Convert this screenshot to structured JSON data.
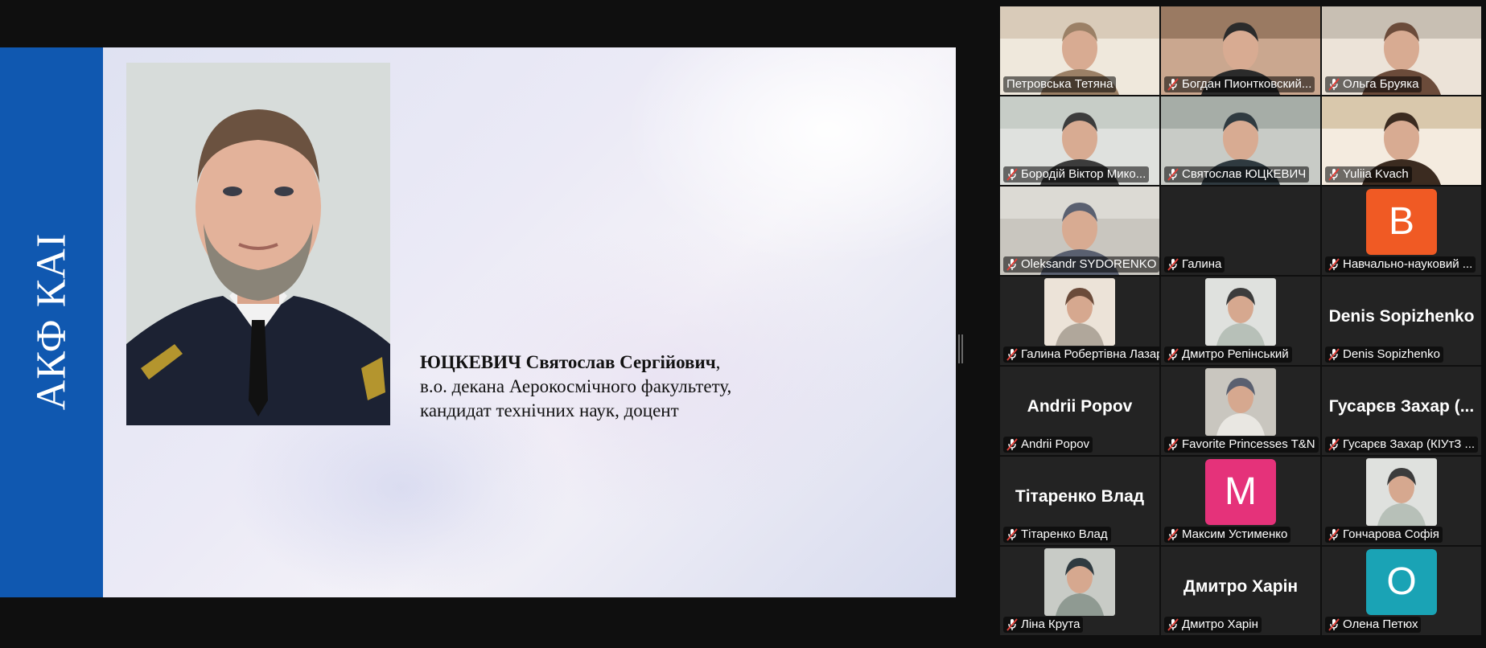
{
  "slide": {
    "band_text": "АКФ КАІ",
    "name_bold": "ЮЦКЕВИЧ Святослав Сергійович",
    "name_suffix": ",",
    "line2": "в.о. декана Аерокосмічного факультету,",
    "line3": "кандидат технічних наук, доцент",
    "band_color": "#1058b0"
  },
  "participants": [
    {
      "name": "Петровська Тетяна",
      "muted": false,
      "active": true,
      "kind": "video"
    },
    {
      "name": "Богдан Пионтковский...",
      "muted": true,
      "kind": "video"
    },
    {
      "name": "Ольга Бруяка",
      "muted": true,
      "kind": "video"
    },
    {
      "name": "Бородій Віктор Мико...",
      "muted": true,
      "kind": "video"
    },
    {
      "name": "Святослав ЮЦКЕВИЧ",
      "muted": true,
      "kind": "video"
    },
    {
      "name": "Yuliia Kvach",
      "muted": true,
      "kind": "video"
    },
    {
      "name": "Oleksandr SYDORENKO",
      "muted": true,
      "kind": "video"
    },
    {
      "name": "Галина",
      "muted": true,
      "kind": "blank"
    },
    {
      "name": "Навчально-науковий ...",
      "muted": true,
      "kind": "avatar",
      "letter": "B",
      "color": "#f05a24"
    },
    {
      "name": "Галина Робертівна Лазар...",
      "muted": true,
      "kind": "photo"
    },
    {
      "name": "Дмитро Репінський",
      "muted": true,
      "kind": "photo"
    },
    {
      "name": "Denis Sopizhenko",
      "muted": true,
      "kind": "text",
      "big": "Denis Sopizhenko"
    },
    {
      "name": "Andrii Popov",
      "muted": true,
      "kind": "text",
      "big": "Andrii Popov"
    },
    {
      "name": "Favorite Princesses T&N",
      "muted": true,
      "kind": "photo"
    },
    {
      "name": "Гусарєв Захар (КІУтЗ ...",
      "muted": true,
      "kind": "text",
      "big": "Гусарєв Захар (..."
    },
    {
      "name": "Тітаренко Влад",
      "muted": true,
      "kind": "text",
      "big": "Тітаренко Влад"
    },
    {
      "name": "Максим Устименко",
      "muted": true,
      "kind": "avatar",
      "letter": "M",
      "color": "#e5327a"
    },
    {
      "name": "Гончарова Софія",
      "muted": true,
      "kind": "photo"
    },
    {
      "name": "Ліна Крута",
      "muted": true,
      "kind": "photo"
    },
    {
      "name": "Дмитро Харін",
      "muted": true,
      "kind": "text",
      "big": "Дмитро Харін"
    },
    {
      "name": "Олена Петюх",
      "muted": true,
      "kind": "avatar",
      "letter": "O",
      "color": "#1aa3b5"
    }
  ]
}
